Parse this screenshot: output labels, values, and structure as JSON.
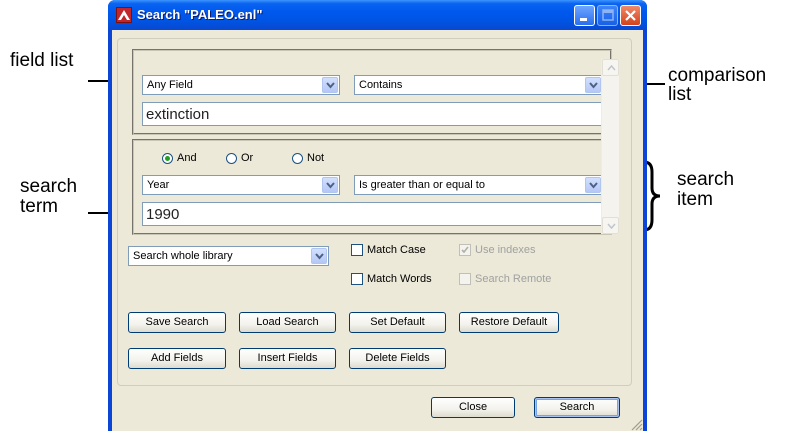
{
  "callouts": {
    "field_list": "field list",
    "search_term_1": "search",
    "search_term_2": "term",
    "comparison_1": "comparison",
    "comparison_2": "list",
    "search_item_1": "search",
    "search_item_2": "item"
  },
  "window": {
    "title": "Search \"PALEO.enl\""
  },
  "row1": {
    "field": "Any Field",
    "comparison": "Contains",
    "term": "extinction"
  },
  "logic": {
    "and": "And",
    "or": "Or",
    "not": "Not",
    "selected": "And"
  },
  "row2": {
    "field": "Year",
    "comparison": "Is greater than or equal to",
    "term": "1990"
  },
  "scope": {
    "value": "Search whole library"
  },
  "options": {
    "match_case": "Match Case",
    "match_words": "Match Words",
    "use_indexes": "Use indexes",
    "search_remote": "Search Remote"
  },
  "buttons": {
    "save_search": "Save Search",
    "load_search": "Load Search",
    "set_default": "Set Default",
    "restore_default": "Restore Default",
    "add_fields": "Add Fields",
    "insert_fields": "Insert Fields",
    "delete_fields": "Delete Fields",
    "close": "Close",
    "search": "Search"
  },
  "colors": {
    "titlebar": "#0054e3",
    "dialog_bg": "#ece9d8",
    "close_button": "#d5421a"
  }
}
